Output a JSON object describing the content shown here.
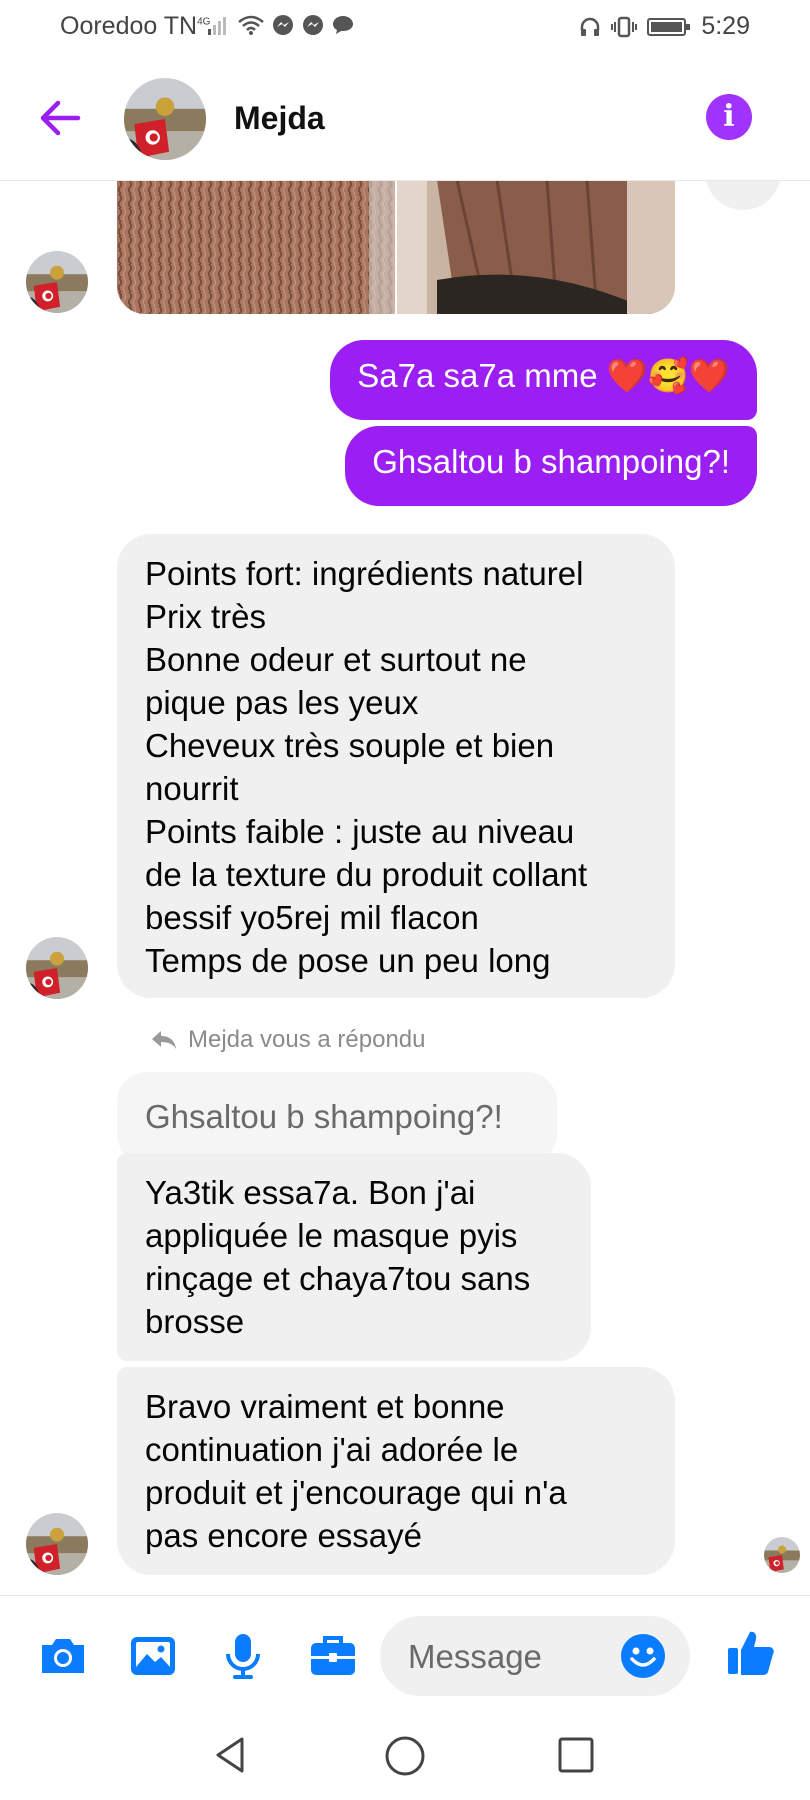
{
  "status_bar": {
    "carrier": "Ooredoo TN",
    "network": "4G",
    "time": "5:29"
  },
  "header": {
    "contact_name": "Mejda"
  },
  "messages": {
    "out1": "Sa7a sa7a mme ❤️🥰❤️",
    "out2": "Ghsaltou b shampoing?!",
    "in1": [
      "Points fort: ingrédients naturel",
      "Prix très",
      "Bonne odeur et surtout ne",
      "pique pas les yeux",
      "Cheveux très souple et bien",
      "nourrit",
      "Points faible : juste au   niveau",
      "de la texture du produit collant",
      "bessif yo5rej mil flacon",
      "Temps de pose un peu long"
    ],
    "reply_note": "Mejda vous a répondu",
    "quoted": "Ghsaltou b shampoing?!",
    "in2": [
      "Ya3tik essa7a. Bon j'ai",
      "appliquée le masque pyis",
      "rinçage et chaya7tou sans",
      "brosse"
    ],
    "in3": [
      "Bravo vraiment et bonne",
      "continuation j'ai adorée le",
      "produit et j'encourage  qui n'a",
      "pas encore essayé"
    ]
  },
  "composer": {
    "placeholder": "Message"
  },
  "colors": {
    "accent": "#9b1ff2",
    "icon_blue": "#0a7cff",
    "incoming_bg": "#f0f0f0"
  },
  "icons": [
    "back-arrow-icon",
    "info-icon",
    "camera-icon",
    "image-icon",
    "microphone-icon",
    "briefcase-icon",
    "emoji-icon",
    "thumbs-up-icon",
    "reply-icon",
    "nav-back-icon",
    "nav-home-icon",
    "nav-recents-icon"
  ]
}
